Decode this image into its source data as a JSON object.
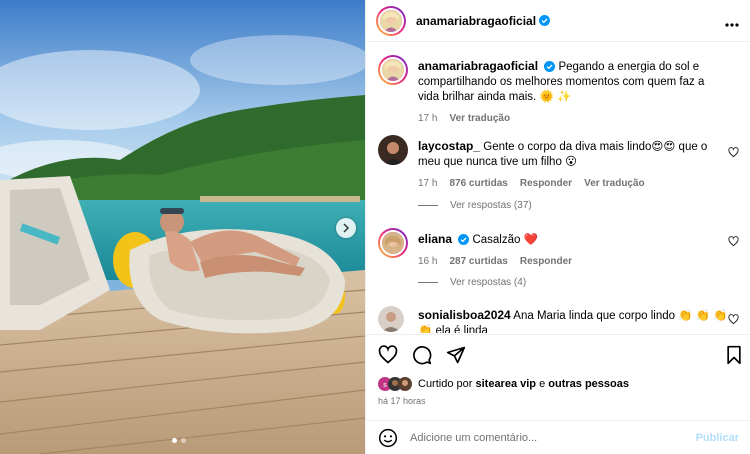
{
  "post": {
    "username": "anamariabragaoficial",
    "caption_text": "Pegando a energia do sol e compartilhando os melhores momentos com quem faz a vida brilhar ainda mais. 🌞 ✨",
    "caption_time": "17 h",
    "caption_translate": "Ver tradução"
  },
  "comments": [
    {
      "username": "laycostap_",
      "text": "Gente o corpo da diva mais lindo😍😍 que o meu que nunca tive um filho 😮",
      "time": "17 h",
      "likes": "876 curtidas",
      "reply": "Responder",
      "translate": "Ver tradução",
      "replies": "Ver respostas (37)"
    },
    {
      "username": "eliana",
      "text": "Casalzão ❤️",
      "time": "16 h",
      "likes": "287 curtidas",
      "reply": "Responder",
      "replies": "Ver respostas (4)"
    },
    {
      "username": "sonialisboa2024",
      "text": "Ana Maria linda que corpo lindo 👏 👏 👏 👏 ela é linda"
    }
  ],
  "footer": {
    "liked_by_prefix": "Curtido por",
    "liked_by_user": "sitearea vip",
    "liked_by_and": "e",
    "liked_by_others": "outras pessoas",
    "post_time": "há 17 horas",
    "comment_placeholder": "Adicione um comentário...",
    "publish_label": "Publicar"
  },
  "colors": {
    "accent_link": "#b2dffc",
    "meta_gray": "#737373",
    "verified_blue": "#0095f6"
  },
  "icons": [
    "more-icon",
    "verified-icon",
    "heart-icon",
    "comment-icon",
    "share-icon",
    "bookmark-icon",
    "emoji-icon",
    "chevron-right-icon"
  ]
}
